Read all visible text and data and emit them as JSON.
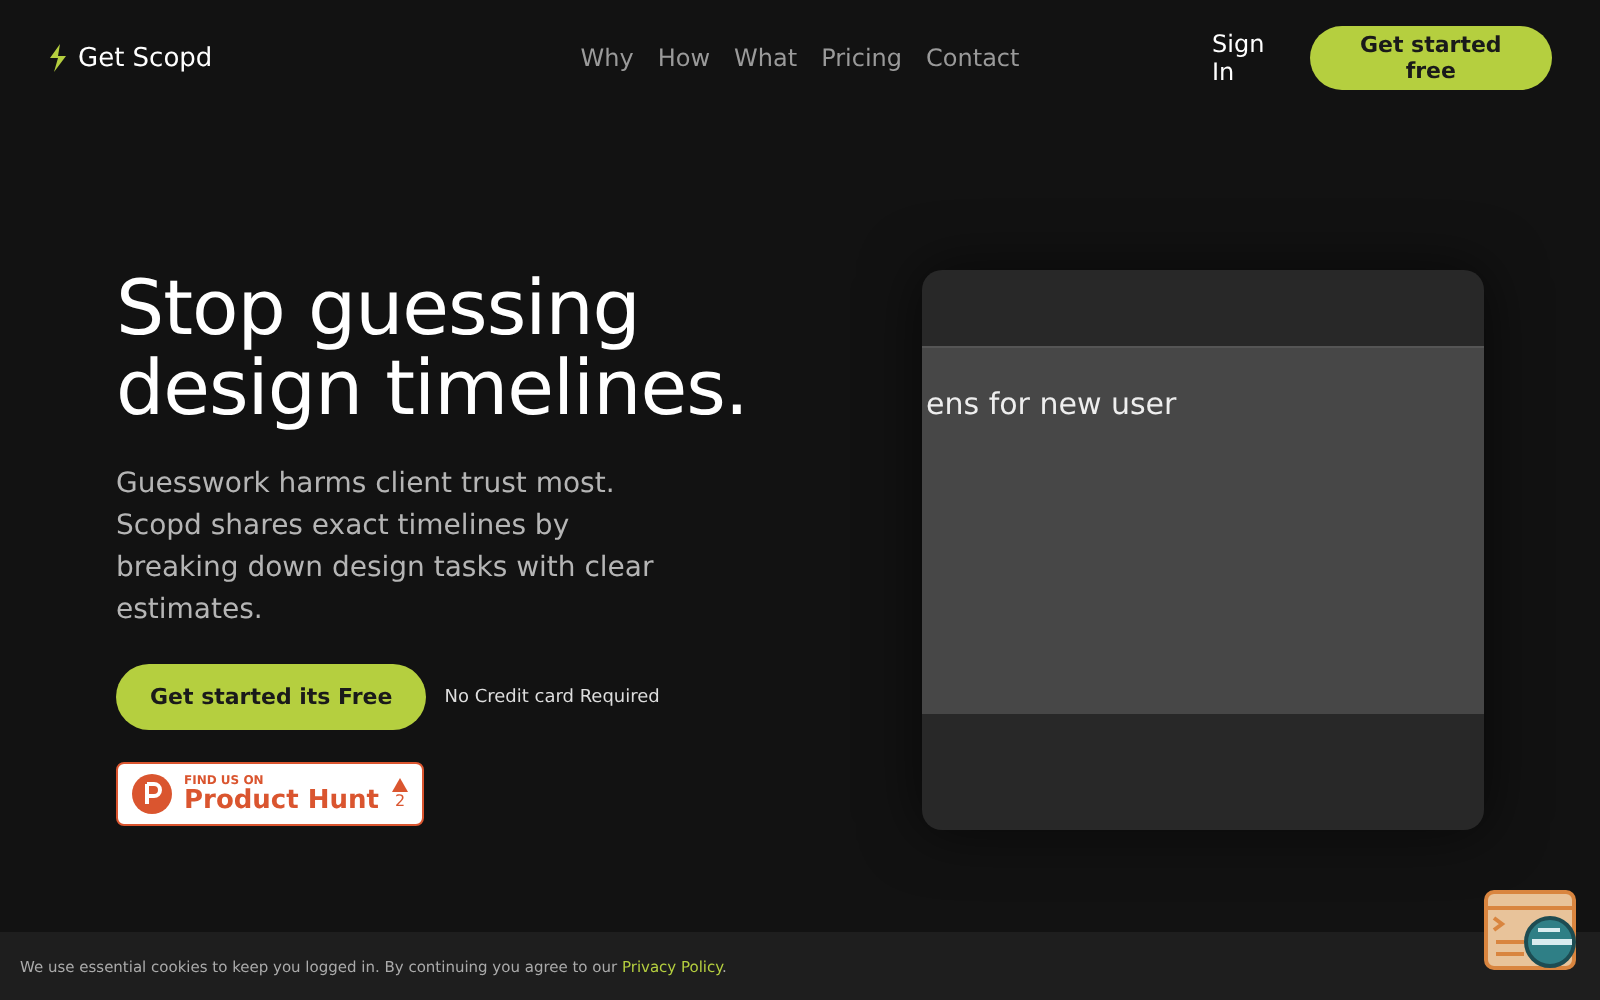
{
  "nav": {
    "brand": "Get Scopd",
    "links": [
      "Why",
      "How",
      "What",
      "Pricing",
      "Contact"
    ],
    "sign_in": "Sign In",
    "cta": "Get started free"
  },
  "hero": {
    "title_lines": [
      "Stop guessing",
      "design timelines."
    ],
    "description": "Guesswork harms client trust most. Scopd shares exact timelines by breaking down design tasks with clear estimates.",
    "cta": "Get started its Free",
    "note": "No Credit card Required",
    "product_hunt": {
      "eyebrow": "FIND US ON",
      "name": "Product Hunt",
      "votes": "2"
    }
  },
  "preview": {
    "caption": "ens for new user"
  },
  "cookie": {
    "text": "We use essential cookies to keep you logged in. By continuing you agree to our ",
    "link": "Privacy Policy",
    "end": "."
  }
}
